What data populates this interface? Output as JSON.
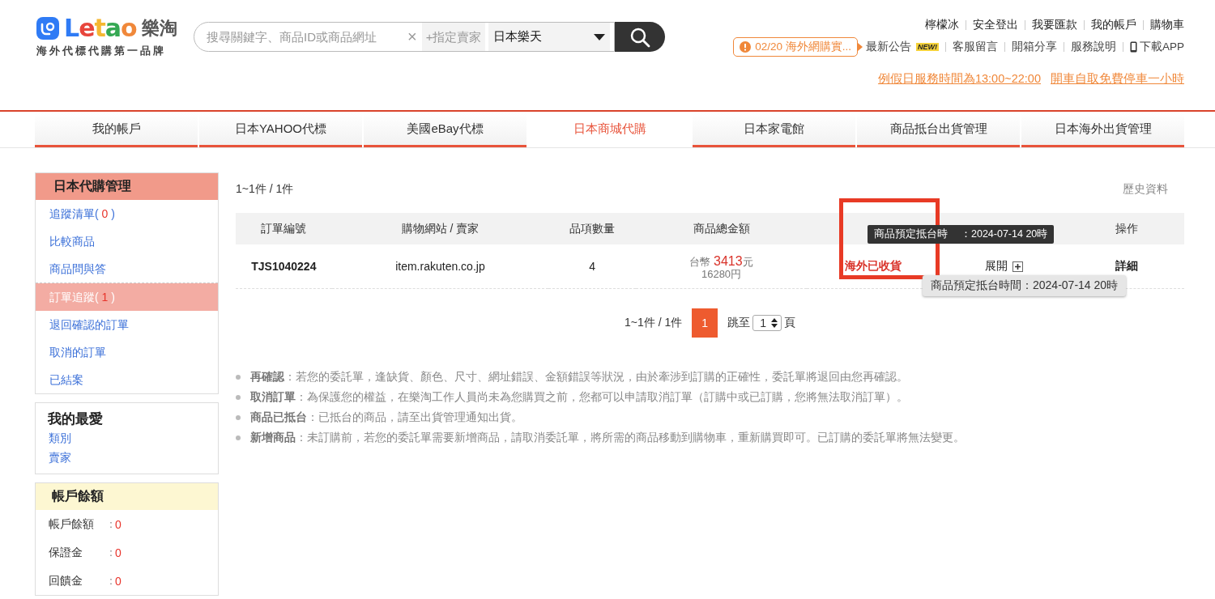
{
  "logo": {
    "wordmark": "Letao",
    "cn": "樂淘",
    "tagline": "海外代標代購第一品牌"
  },
  "search": {
    "placeholder": "搜尋關鍵字、商品ID或商品網址",
    "clear": "×",
    "seller_button": "+指定賣家",
    "site": "日本樂天"
  },
  "user_links": [
    "檸檬冰",
    "安全登出",
    "我要匯款",
    "我的帳戶",
    "購物車"
  ],
  "notice": "02/20 海外網購實...",
  "info_links": [
    {
      "label": "最新公告",
      "badge": "NEW!",
      "kind": "text"
    },
    {
      "label": "客服留言",
      "kind": "text"
    },
    {
      "label": "開箱分享",
      "kind": "text"
    },
    {
      "label": "服務說明",
      "kind": "text"
    },
    {
      "label": "下載APP",
      "kind": "app"
    }
  ],
  "promo_links": [
    "例假日服務時間為13:00~22:00",
    "開車自取免費停車一小時"
  ],
  "tabs": [
    {
      "label": "我的帳戶",
      "selected": false
    },
    {
      "label": "日本YAHOO代標",
      "selected": false
    },
    {
      "label": "美國eBay代標",
      "selected": false
    },
    {
      "label": "日本商城代購",
      "selected": true
    },
    {
      "label": "日本家電館",
      "selected": false
    },
    {
      "label": "商品抵台出貨管理",
      "selected": false
    },
    {
      "label": "日本海外出貨管理",
      "selected": false
    }
  ],
  "sidebar": {
    "management": {
      "title": "日本代購管理",
      "groups": [
        [
          {
            "label": "追蹤清單(",
            "count": "0",
            "close": ")",
            "selected": false
          },
          {
            "label": "比較商品",
            "selected": false
          },
          {
            "label": "商品問與答",
            "selected": false
          }
        ],
        [
          {
            "label": "訂單追蹤(",
            "count": "1",
            "close": ")",
            "selected": true
          },
          {
            "label": "退回確認的訂單",
            "selected": false
          },
          {
            "label": "取消的訂單",
            "selected": false
          },
          {
            "label": "已結案",
            "selected": false
          }
        ]
      ]
    },
    "favorites": {
      "title": "我的最愛",
      "items": [
        "類別",
        "賣家"
      ]
    },
    "balance": {
      "title": "帳戶餘額",
      "rows": [
        {
          "label": "帳戶餘額",
          "colon": "：",
          "value": "0"
        },
        {
          "label": "保證金",
          "colon": "：",
          "value": "0"
        },
        {
          "label": "回饋金",
          "colon": "：",
          "value": "0"
        }
      ]
    }
  },
  "result_count": "1~1件 / 1件",
  "history_link": "歷史資料",
  "table": {
    "columns": [
      "訂單編號",
      "購物網站 / 賣家",
      "品項數量",
      "商品總金額",
      null,
      null,
      "操作"
    ],
    "rows": [
      {
        "order_no": "TJS1040224",
        "site": "item.rakuten.co.jp",
        "quantity": "4",
        "currency": "台幣",
        "amount": "3413",
        "unit": "元",
        "yen": "16280円",
        "status": "海外已收貨",
        "expand": "展開",
        "action": "詳細"
      }
    ]
  },
  "tooltips": [
    {
      "parts": [
        "商品預定抵台時",
        "：2024-07-14 20時"
      ],
      "kind": "dark"
    },
    {
      "parts": [
        "商品預定抵台時間：2024-07-14 20時"
      ],
      "kind": "light"
    }
  ],
  "pagination": {
    "summary": "1~1件 / 1件",
    "pages": [
      {
        "label": "1",
        "selected": true
      }
    ],
    "jump_label": "跳至",
    "jump_value": "1",
    "page_unit": "頁"
  },
  "notes": [
    "**再確認**：若您的委託單，逢缺貨、顏色、尺寸、網址錯誤、金額錯誤等狀況，由於牽涉到訂購的正確性，委託單將退回由您再確認。",
    "**取消訂單**：為保護您的權益，在樂淘工作人員尚未為您購買之前，您都可以申請取消訂單（訂購中或已訂購，您將無法取消訂單）。",
    "**商品已抵台**：已抵台的商品，請至出貨管理通知出貨。",
    "**新增商品**：未訂購前，若您的委託單需要新增商品，請取消委託單，將所需的商品移動到購物車，重新購買即可。已訂購的委託單將無法變更。"
  ]
}
